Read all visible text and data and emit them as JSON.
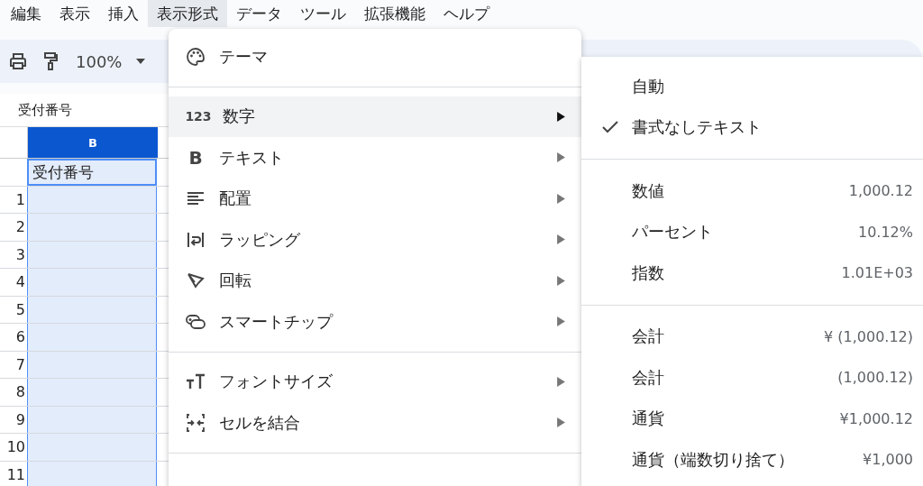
{
  "menu_bar": [
    {
      "label": "編集",
      "selected": false
    },
    {
      "label": "表示",
      "selected": false
    },
    {
      "label": "挿入",
      "selected": false
    },
    {
      "label": "表示形式",
      "selected": true
    },
    {
      "label": "データ",
      "selected": false
    },
    {
      "label": "ツール",
      "selected": false
    },
    {
      "label": "拡張機能",
      "selected": false
    },
    {
      "label": "ヘルプ",
      "selected": false
    }
  ],
  "toolbar": {
    "zoom": "100%"
  },
  "formula_bar": {
    "value": "受付番号"
  },
  "grid": {
    "column_header": "B",
    "header_cell": "受付番号",
    "row_numbers": [
      "1",
      "2",
      "3",
      "4",
      "5",
      "6",
      "7",
      "8",
      "9",
      "10",
      "11"
    ]
  },
  "format_menu": {
    "items": [
      {
        "kind": "theme",
        "label": "テーマ",
        "submenu": false,
        "selected": false
      },
      {
        "kind": "divider"
      },
      {
        "kind": "glyph",
        "icon_text": "123",
        "label": "数字",
        "submenu": true,
        "selected": true
      },
      {
        "kind": "glyph",
        "icon_text": "B",
        "label": "テキスト",
        "submenu": true,
        "selected": false
      },
      {
        "kind": "align",
        "label": "配置",
        "submenu": true,
        "selected": false
      },
      {
        "kind": "wrap",
        "label": "ラッピング",
        "submenu": true,
        "selected": false
      },
      {
        "kind": "rotate",
        "label": "回転",
        "submenu": true,
        "selected": false
      },
      {
        "kind": "chip",
        "label": "スマートチップ",
        "submenu": true,
        "selected": false
      },
      {
        "kind": "divider"
      },
      {
        "kind": "fontsize",
        "label": "フォントサイズ",
        "submenu": true,
        "selected": false
      },
      {
        "kind": "merge",
        "label": "セルを結合",
        "submenu": true,
        "selected": false
      },
      {
        "kind": "divider"
      }
    ]
  },
  "number_submenu": {
    "items": [
      {
        "kind": "item",
        "label": "自動",
        "checked": false
      },
      {
        "kind": "item",
        "label": "書式なしテキスト",
        "checked": true
      },
      {
        "kind": "divider"
      },
      {
        "kind": "item",
        "label": "数値",
        "example": "1,000.12",
        "checked": false
      },
      {
        "kind": "item",
        "label": "パーセント",
        "example": "10.12%",
        "checked": false
      },
      {
        "kind": "item",
        "label": "指数",
        "example": "1.01E+03",
        "checked": false
      },
      {
        "kind": "divider"
      },
      {
        "kind": "item",
        "label": "会計",
        "example": "¥ (1,000.12)",
        "checked": false
      },
      {
        "kind": "item",
        "label": "会計",
        "example": "(1,000.12)",
        "checked": false
      },
      {
        "kind": "item",
        "label": "通貨",
        "example": "¥1,000.12",
        "checked": false
      },
      {
        "kind": "item",
        "label": "通貨（端数切り捨て）",
        "example": "¥1,000",
        "checked": false
      }
    ]
  }
}
